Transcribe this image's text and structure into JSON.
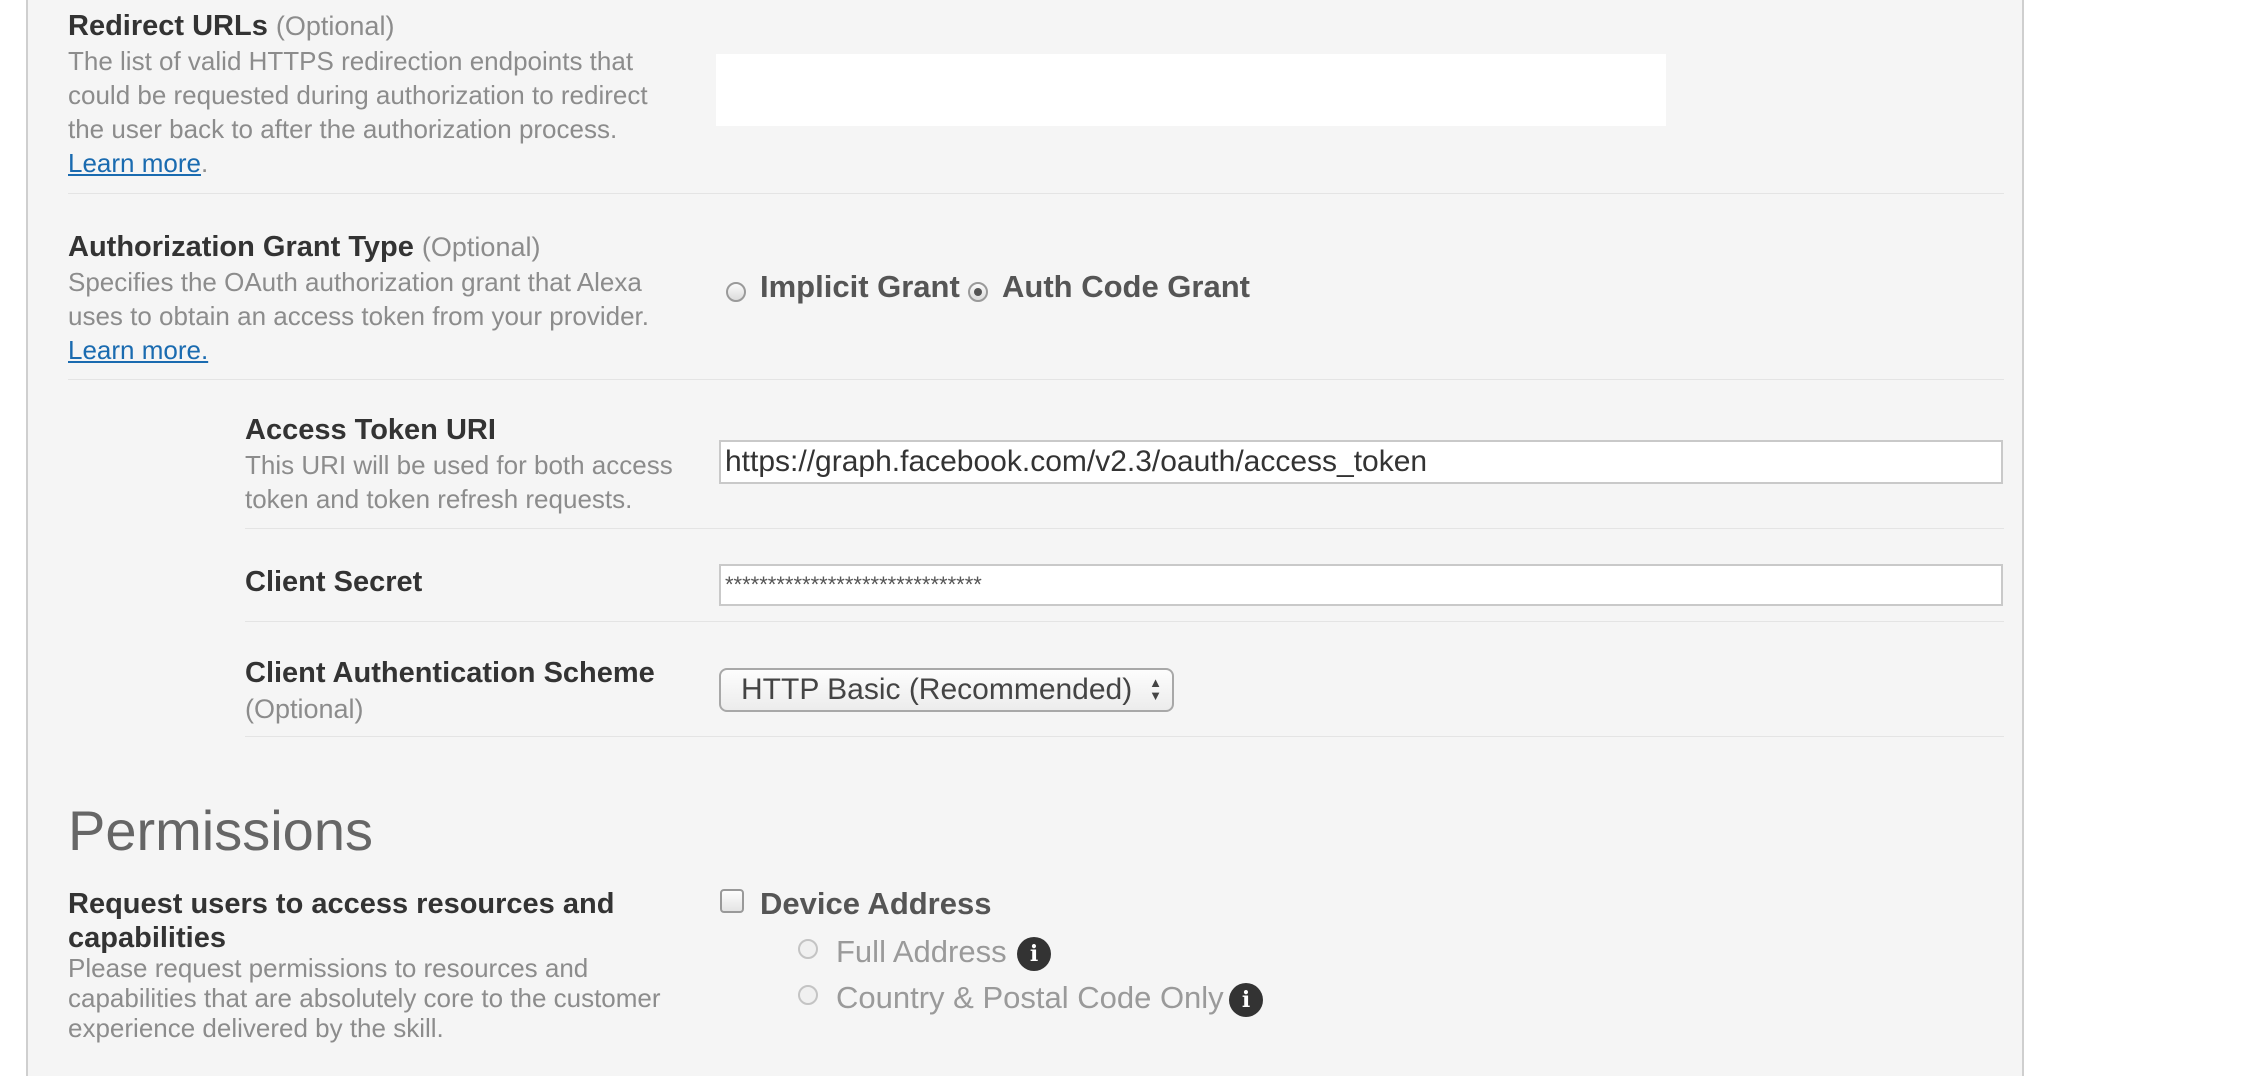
{
  "redirect": {
    "label": "Redirect URLs",
    "optional": "(Optional)",
    "desc_lines": [
      "The list of valid HTTPS redirection endpoints that",
      "could be requested during authorization to redirect",
      "the user back to after the authorization process."
    ],
    "link": "Learn more",
    "link_suffix": "."
  },
  "grant": {
    "label": "Authorization Grant Type",
    "optional": "(Optional)",
    "desc_lines": [
      "Specifies the OAuth authorization grant that Alexa",
      "uses to obtain an access token from your provider."
    ],
    "link": "Learn more.",
    "options": [
      {
        "label": "Implicit Grant",
        "selected": false
      },
      {
        "label": "Auth Code Grant",
        "selected": true
      }
    ]
  },
  "access_token": {
    "label": "Access Token URI",
    "desc_lines": [
      "This URI will be used for both access",
      "token and token refresh requests."
    ],
    "value": "https://graph.facebook.com/v2.3/oauth/access_token"
  },
  "client_secret": {
    "label": "Client Secret",
    "value": "******************************"
  },
  "auth_scheme": {
    "label": "Client Authentication Scheme",
    "optional": "(Optional)",
    "selected": "HTTP Basic (Recommended)"
  },
  "permissions": {
    "heading": "Permissions",
    "label_lines": [
      "Request users to access resources and",
      "capabilities"
    ],
    "desc_lines": [
      "Please request permissions to resources and",
      "capabilities that are absolutely core to the customer",
      "experience delivered by the skill."
    ],
    "device_address": {
      "label": "Device Address",
      "checked": false,
      "options": [
        {
          "label": "Full Address"
        },
        {
          "label": "Country & Postal Code Only"
        }
      ]
    }
  },
  "icons": {
    "info": "info-icon",
    "select_arrows": "updown-arrows-icon"
  }
}
